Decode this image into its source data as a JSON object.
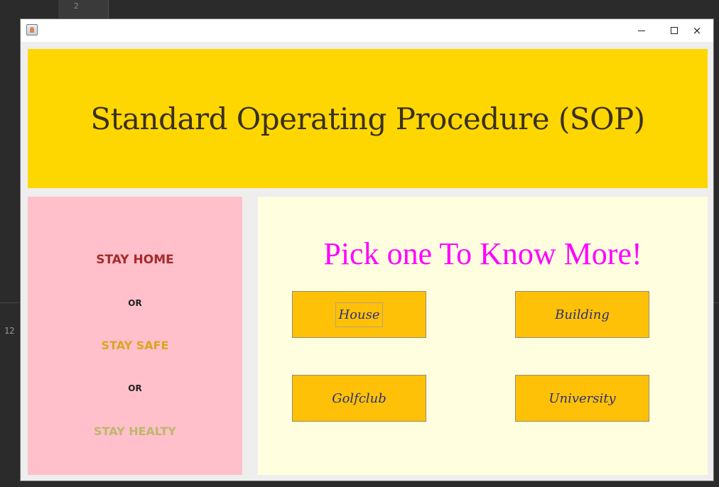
{
  "background": {
    "tab_number": "2",
    "line_number": "12"
  },
  "window": {
    "title": "",
    "controls": {
      "minimize": "minimize",
      "maximize": "maximize",
      "close": "×"
    }
  },
  "header": {
    "title": "Standard Operating Procedure (SOP)",
    "color": "#ffd700"
  },
  "left_panel": {
    "color": "#ffc0cb",
    "stay_home": "STAY HOME",
    "or_1": "OR",
    "stay_safe": "STAY SAFE",
    "or_2": "OR",
    "stay_healty": "STAY HEALTY"
  },
  "right_panel": {
    "color": "#ffffe0",
    "title": "Pick one To Know More!",
    "buttons": {
      "house": "House",
      "building": "Building",
      "golfclub": "Golfclub",
      "university": "University"
    }
  },
  "icons": {
    "app": "java-cup-icon"
  }
}
